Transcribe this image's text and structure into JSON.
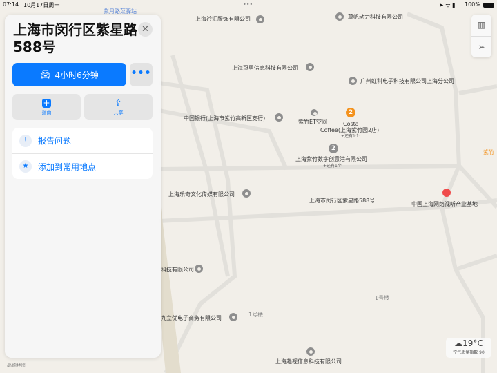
{
  "status": {
    "time": "07:14",
    "date": "10月17日周一",
    "battery": "100%"
  },
  "panel": {
    "title": "上海市闵行区紫星路588号",
    "route_label": "4小时6分钟",
    "more_label": "•••",
    "guide_label": "指南",
    "share_label": "共享",
    "report_label": "报告问题",
    "favorite_label": "添加到常用地点"
  },
  "map": {
    "labels": [
      "紫月路菜驿站",
      "上海衿汇服饰有限公司",
      "慕帆动力科技有限公司",
      "上海冠勇信息科技有限公司",
      "广州虹科电子科技有限公司上海分公司",
      "中国银行(上海市紫竹高新区支行)",
      "紫竹ET空间",
      "Costa",
      "Coffee(上海紫竹园2店)",
      "+还有1个",
      "上海紫竹数字创意港有限公司",
      "+还有1个",
      "紫竹",
      "上海乐奇文化传媒有限公司",
      "上海市闵行区紫星路588号",
      "中国上海网络视听产业基地",
      "科技有限公司",
      "九立优电子商务有限公司",
      "1号楼",
      "1号楼",
      "上海趋视信息科技有限公司",
      "高德地图"
    ],
    "cluster_counts": [
      "2",
      "2"
    ]
  },
  "weather": {
    "temp": "19°C",
    "aqi": "空气质量指数 90"
  },
  "colors": {
    "accent": "#0a7aff",
    "pin": "#f04b4b",
    "cluster": "#f4921d"
  }
}
